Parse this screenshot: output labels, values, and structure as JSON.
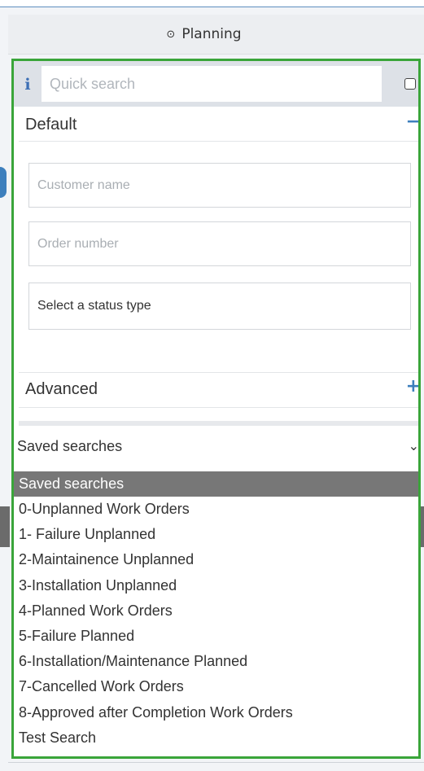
{
  "header": {
    "title": "Planning",
    "icon": "clock-icon"
  },
  "quick_search": {
    "placeholder": "Quick search",
    "info_icon": "i"
  },
  "default_section": {
    "label": "Default",
    "toggle": "−",
    "customer_name_placeholder": "Customer name",
    "order_number_placeholder": "Order number",
    "status_type": "Select a status type"
  },
  "advanced_section": {
    "label": "Advanced",
    "toggle": "+"
  },
  "saved_searches": {
    "selected": "Saved searches",
    "chevron": "⌄",
    "header": "Saved searches",
    "options": [
      "0-Unplanned Work Orders",
      "1- Failure Unplanned",
      "2-Maintainence Unplanned",
      "3-Installation Unplanned",
      "4-Planned Work Orders",
      "5-Failure Planned",
      "6-Installation/Maintenance Planned",
      "7-Cancelled Work Orders",
      "8-Approved after Completion Work Orders",
      "Test Search"
    ]
  },
  "colors": {
    "highlight_border": "#3aa53a",
    "accent": "#3d7fbd",
    "list_header_bg": "#777777"
  }
}
